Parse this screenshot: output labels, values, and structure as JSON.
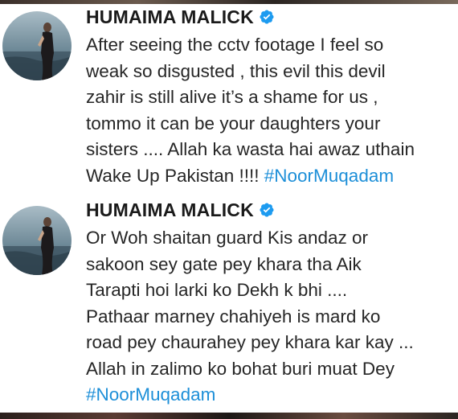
{
  "tweets": [
    {
      "author": "HUMAIMA MALICK",
      "verified_icon": "verified-badge-icon",
      "lines": [
        "After seeing the cctv footage I feel so",
        "weak so disgusted , this evil this devil",
        "zahir is still alive it’s a shame for us ,",
        "tommo it can be your daughters your",
        "sisters .... Allah ka wasta hai awaz uthain"
      ],
      "last_line_text": "Wake Up Pakistan !!!! ",
      "hashtag": "#NoorMuqadam"
    },
    {
      "author": "HUMAIMA MALICK",
      "verified_icon": "verified-badge-icon",
      "lines": [
        "Or Woh shaitan guard Kis andaz or",
        "sakoon sey gate pey khara tha Aik",
        "Tarapti hoi larki ko Dekh k bhi ....",
        "Pathaar marney chahiyeh is mard ko",
        "road pey chaurahey pey khara kar kay ...",
        "Allah in zalimo ko bohat buri muat Dey"
      ],
      "hashtag": "#NoorMuqadam"
    }
  ],
  "colors": {
    "hashtag": "#1d8fd8",
    "verified": "#1d9bf0",
    "text": "#262626",
    "name": "#1a1a1a"
  }
}
